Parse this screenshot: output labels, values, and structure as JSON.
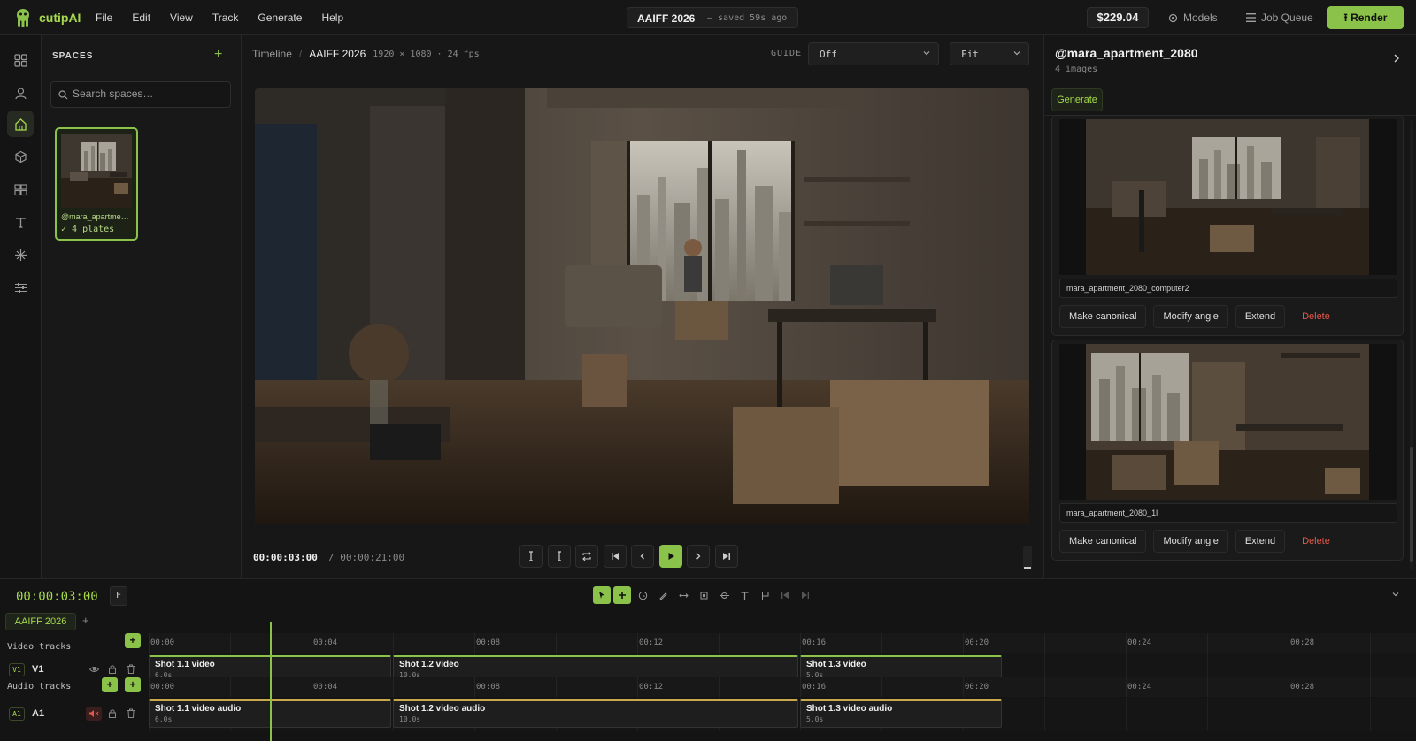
{
  "app": {
    "name": "cutipAI",
    "menu": [
      "File",
      "Edit",
      "View",
      "Track",
      "Generate",
      "Help"
    ]
  },
  "project": {
    "name": "AAIFF 2026",
    "saved": "— saved 59s ago"
  },
  "topbar": {
    "credits": "$229.04",
    "models": "Models",
    "job_queue": "Job Queue",
    "render": "Render"
  },
  "spaces": {
    "header": "SPACES",
    "search_placeholder": "Search spaces…",
    "cards": [
      {
        "name": "@mara_apartme…",
        "plates": "✓ 4 plates"
      }
    ]
  },
  "viewer": {
    "breadcrumb_root": "Timeline",
    "breadcrumb_sep": "/",
    "breadcrumb_current": "AAIFF 2026",
    "spec": "1920 × 1080 · 24 fps",
    "guide_label": "GUIDE",
    "guide_value": "Off",
    "fit_value": "Fit",
    "timecode_current": "00:00:03:00",
    "timecode_sep": "/",
    "timecode_total": "00:00:21:00"
  },
  "right_panel": {
    "title": "@mara_apartment_2080",
    "subtitle": "4 images",
    "generate_tab": "Generate",
    "images": [
      {
        "filename": "mara_apartment_2080_computer2",
        "actions": [
          "Make canonical",
          "Modify angle",
          "Extend",
          "Delete"
        ]
      },
      {
        "filename": "mara_apartment_2080_1l",
        "actions": [
          "Make canonical",
          "Modify angle",
          "Extend",
          "Delete"
        ]
      }
    ]
  },
  "timeline": {
    "timecode": "00:00:03:00",
    "f_button": "F",
    "sequence_tab": "AAIFF 2026",
    "video_tracks_label": "Video tracks",
    "audio_tracks_label": "Audio tracks",
    "ruler_ticks": [
      "00:00",
      "00:04",
      "00:08",
      "00:12",
      "00:16",
      "00:20",
      "00:24",
      "00:28"
    ],
    "total_seconds": 31,
    "playhead_seconds": 3,
    "video_track": {
      "badge": "V1",
      "name": "V1",
      "clips": [
        {
          "title": "Shot 1.1 video",
          "duration": "6.0s",
          "start": 0,
          "length": 6
        },
        {
          "title": "Shot 1.2 video",
          "duration": "10.0s",
          "start": 6,
          "length": 10
        },
        {
          "title": "Shot 1.3 video",
          "duration": "5.0s",
          "start": 16,
          "length": 5
        }
      ]
    },
    "audio_track": {
      "badge": "A1",
      "name": "A1",
      "clips": [
        {
          "title": "Shot 1.1 video audio",
          "duration": "6.0s",
          "start": 0,
          "length": 6
        },
        {
          "title": "Shot 1.2 video audio",
          "duration": "10.0s",
          "start": 6,
          "length": 10
        },
        {
          "title": "Shot 1.3 video audio",
          "duration": "5.0s",
          "start": 16,
          "length": 5
        }
      ]
    }
  },
  "colors": {
    "accent": "#8bc34a",
    "accent_text": "#a6d94c",
    "delete": "#e8584a",
    "audio_clip": "#c8a84a"
  }
}
